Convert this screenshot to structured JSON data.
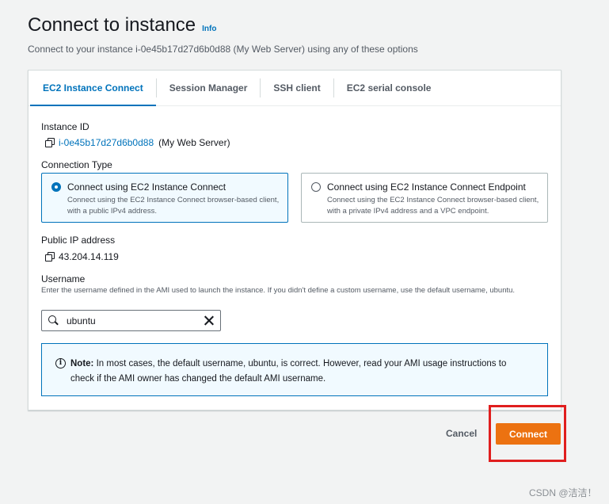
{
  "header": {
    "title": "Connect to instance",
    "info_link": "Info",
    "subtitle": "Connect to your instance i-0e45b17d27d6b0d88 (My Web Server) using any of these options"
  },
  "tabs": [
    {
      "label": "EC2 Instance Connect",
      "active": true
    },
    {
      "label": "Session Manager",
      "active": false
    },
    {
      "label": "SSH client",
      "active": false
    },
    {
      "label": "EC2 serial console",
      "active": false
    }
  ],
  "instance": {
    "label": "Instance ID",
    "id": "i-0e45b17d27d6b0d88",
    "name": "(My Web Server)"
  },
  "connection_type": {
    "label": "Connection Type",
    "options": [
      {
        "title": "Connect using EC2 Instance Connect",
        "desc": "Connect using the EC2 Instance Connect browser-based client, with a public IPv4 address.",
        "selected": true
      },
      {
        "title": "Connect using EC2 Instance Connect Endpoint",
        "desc": "Connect using the EC2 Instance Connect browser-based client, with a private IPv4 address and a VPC endpoint.",
        "selected": false
      }
    ]
  },
  "public_ip": {
    "label": "Public IP address",
    "value": "43.204.14.119"
  },
  "username": {
    "label": "Username",
    "hint": "Enter the username defined in the AMI used to launch the instance. If you didn't define a custom username, use the default username, ubuntu.",
    "value": "ubuntu"
  },
  "note": {
    "bold": "Note:",
    "text": " In most cases, the default username, ubuntu, is correct. However, read your AMI usage instructions to check if the AMI owner has changed the default AMI username."
  },
  "footer": {
    "cancel_label": "Cancel",
    "connect_label": "Connect"
  },
  "watermark": "CSDN @洁洁！",
  "colors": {
    "accent": "#0073bb",
    "primary_button": "#ec7211",
    "highlight": "#e01e1e"
  }
}
